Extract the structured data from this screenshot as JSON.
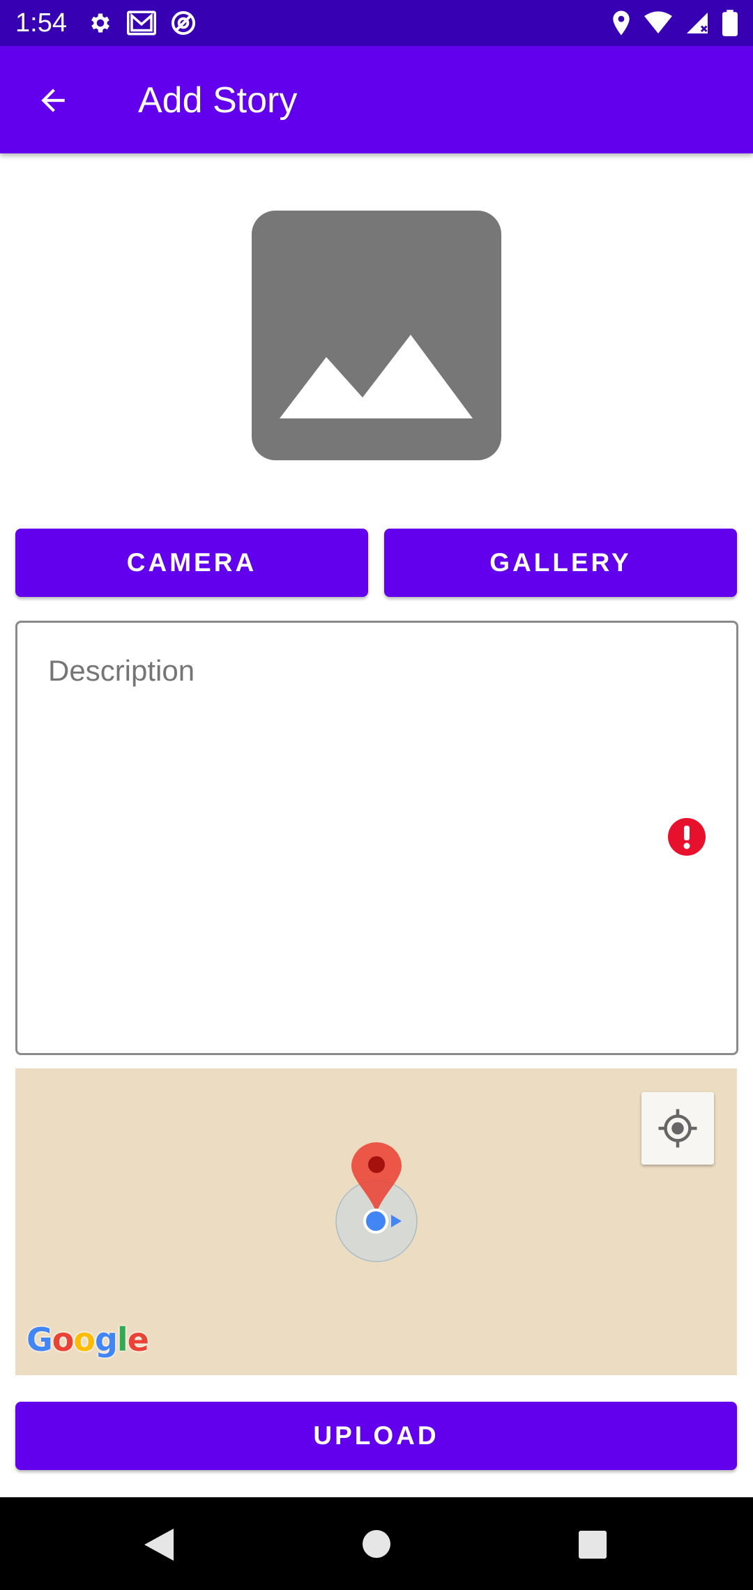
{
  "status_bar": {
    "time": "1:54",
    "left_icons": [
      "settings-icon",
      "gmail-icon",
      "at-sign-icon"
    ],
    "right_icons": [
      "location-icon",
      "wifi-icon",
      "signal-icon",
      "battery-icon"
    ]
  },
  "toolbar": {
    "title": "Add Story",
    "back_icon": "arrow-back-icon"
  },
  "image_preview": {
    "icon": "image-placeholder-icon"
  },
  "buttons": {
    "camera": "CAMERA",
    "gallery": "GALLERY",
    "upload": "UPLOAD"
  },
  "description": {
    "placeholder": "Description",
    "value": "",
    "error_icon": "error-icon"
  },
  "map": {
    "attribution": "Google",
    "locate_icon": "my-location-icon",
    "marker_icon": "map-pin-icon",
    "current_location_icon": "blue-dot-icon"
  },
  "nav_bar": {
    "icons": [
      "nav-back-icon",
      "nav-home-icon",
      "nav-recents-icon"
    ]
  },
  "colors": {
    "primary": "#6200ee",
    "primary_dark": "#3700b3",
    "placeholder_gray": "#777777",
    "map_bg": "#ecdcc1",
    "error": "#e8112d",
    "marker_red": "#ea4335",
    "location_blue": "#4285f4"
  }
}
